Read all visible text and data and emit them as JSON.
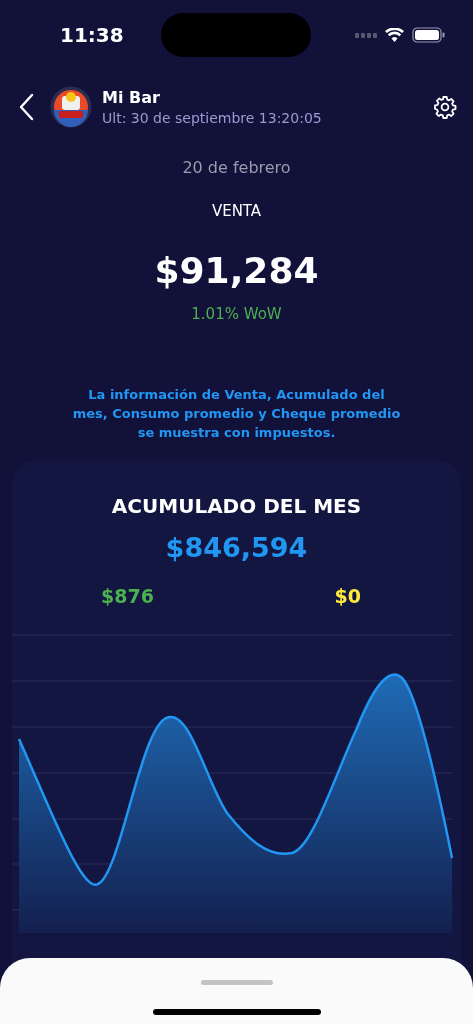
{
  "status_bar": {
    "time": "11:38"
  },
  "header": {
    "title": "Mi Bar",
    "subtitle": "Ult: 30 de septiembre 13:20:05"
  },
  "date": "20 de febrero",
  "sales": {
    "label": "VENTA",
    "value": "$91,284",
    "change": "1.01% WoW"
  },
  "note": "La información de Venta, Acumulado del mes, Consumo promedio y Cheque promedio se muestra con impuestos.",
  "month_card": {
    "title": "ACUMULADO DEL MES",
    "value": "$846,594",
    "figures": [
      {
        "value": "$876",
        "color": "#4caf50"
      },
      {
        "value": "$0",
        "color": "#ffeb3b"
      }
    ]
  }
}
